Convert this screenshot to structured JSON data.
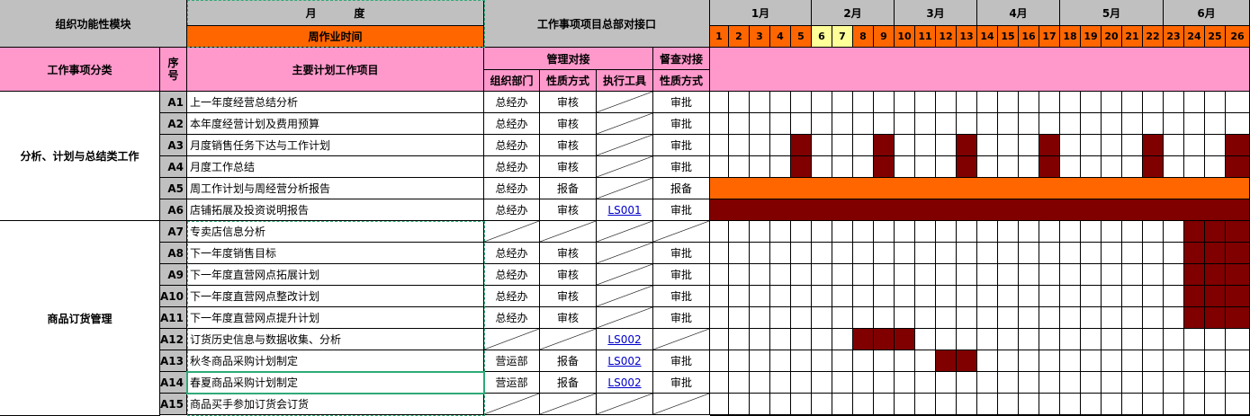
{
  "header": {
    "module_label": "组织功能性模块",
    "month_label": "月          度",
    "week_time_label": "周作业时间",
    "interface_label": "工作事项项目总部对接口"
  },
  "months": [
    "1月",
    "2月",
    "3月",
    "4月",
    "5月",
    "6月"
  ],
  "weeks": [
    "1",
    "2",
    "3",
    "4",
    "5",
    "6",
    "7",
    "8",
    "9",
    "10",
    "11",
    "12",
    "13",
    "14",
    "15",
    "16",
    "17",
    "18",
    "19",
    "20",
    "21",
    "22",
    "23",
    "24",
    "25",
    "26"
  ],
  "highlighted_weeks": [
    "6",
    "7"
  ],
  "subheader": {
    "category_label": "工作事项分类",
    "seq_label": "序号",
    "item_label": "主要计划工作项目",
    "mgmt_label": "管理对接",
    "audit_label": "督查对接",
    "dept_label": "组织部门",
    "nature_label": "性质方式",
    "tool_label": "执行工具",
    "audit_nature_label": "性质方式"
  },
  "groups": [
    {
      "name": "分析、计划与总结类工作"
    },
    {
      "name": "商品订货管理"
    }
  ],
  "rows": [
    {
      "seq": "A1",
      "item": "上一年度经营总结分析",
      "dept": "总经办",
      "nature": "审核",
      "tool": "",
      "audit": "审批",
      "blocks": []
    },
    {
      "seq": "A2",
      "item": "本年度经营计划及费用预算",
      "dept": "总经办",
      "nature": "审核",
      "tool": "",
      "audit": "审批",
      "blocks": []
    },
    {
      "seq": "A3",
      "item": "月度销售任务下达与工作计划",
      "dept": "总经办",
      "nature": "审核",
      "tool": "",
      "audit": "审批",
      "blocks": [
        "5",
        "9",
        "13",
        "17",
        "22",
        "26"
      ]
    },
    {
      "seq": "A4",
      "item": "月度工作总结",
      "dept": "总经办",
      "nature": "审核",
      "tool": "",
      "audit": "审批",
      "blocks": [
        "5",
        "9",
        "13",
        "17",
        "22",
        "26"
      ]
    },
    {
      "seq": "A5",
      "item": "周工作计划与周经营分析报告",
      "dept": "总经办",
      "nature": "报备",
      "tool": "",
      "audit": "报备",
      "bar": "orange"
    },
    {
      "seq": "A6",
      "item": "店铺拓展及投资说明报告",
      "dept": "总经办",
      "nature": "审核",
      "tool": "LS001",
      "audit": "审批",
      "bar": "maroon"
    },
    {
      "seq": "A7",
      "item": "专卖店信息分析",
      "dept": "",
      "nature": "",
      "tool": "",
      "audit": "",
      "blocks": [
        "24",
        "25",
        "26"
      ]
    },
    {
      "seq": "A8",
      "item": "下一年度销售目标",
      "dept": "总经办",
      "nature": "审核",
      "tool": "",
      "audit": "审批",
      "blocks": [
        "24",
        "25",
        "26"
      ]
    },
    {
      "seq": "A9",
      "item": "下一年度直营网点拓展计划",
      "dept": "总经办",
      "nature": "审核",
      "tool": "",
      "audit": "审批",
      "blocks": [
        "24",
        "25",
        "26"
      ]
    },
    {
      "seq": "A10",
      "item": "下一年度直营网点整改计划",
      "dept": "总经办",
      "nature": "审核",
      "tool": "",
      "audit": "审批",
      "blocks": [
        "24",
        "25",
        "26"
      ]
    },
    {
      "seq": "A11",
      "item": "下一年度直营网点提升计划",
      "dept": "总经办",
      "nature": "审核",
      "tool": "",
      "audit": "审批",
      "blocks": [
        "24",
        "25",
        "26"
      ]
    },
    {
      "seq": "A12",
      "item": "订货历史信息与数据收集、分析",
      "dept": "",
      "nature": "",
      "tool": "LS002",
      "audit": "",
      "blocks": [
        "8",
        "9",
        "10"
      ]
    },
    {
      "seq": "A13",
      "item": "秋冬商品采购计划制定",
      "dept": "营运部",
      "nature": "报备",
      "tool": "LS002",
      "audit": "审批",
      "blocks": [
        "12",
        "13"
      ]
    },
    {
      "seq": "A14",
      "item": "春夏商品采购计划制定",
      "dept": "营运部",
      "nature": "报备",
      "tool": "LS002",
      "audit": "审批",
      "blocks": []
    },
    {
      "seq": "A15",
      "item": "商品买手参加订货会订货",
      "dept": "",
      "nature": "",
      "tool": "",
      "audit": "",
      "blocks": []
    }
  ],
  "colors": {
    "header_gray": "#c0c0c0",
    "orange": "#ff6600",
    "pink": "#ff99cc",
    "maroon": "#800000",
    "highlight_yellow": "#ffff99",
    "selection_green": "#2eaa77"
  }
}
